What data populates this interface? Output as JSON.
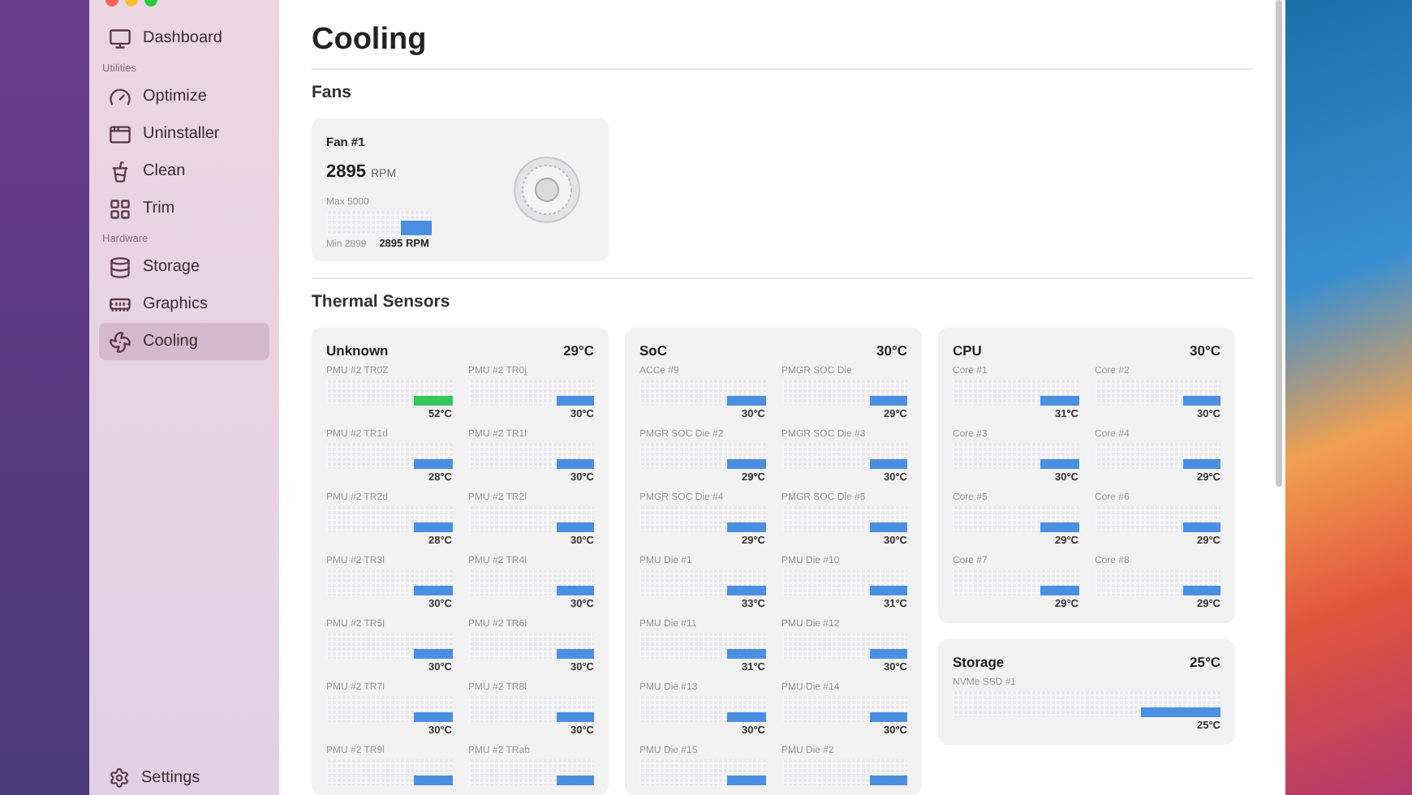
{
  "sidebar": {
    "items": [
      {
        "kind": "item",
        "label": "Dashboard",
        "selected": false
      },
      {
        "kind": "section",
        "label": "Utilities"
      },
      {
        "kind": "item",
        "label": "Optimize",
        "selected": false
      },
      {
        "kind": "item",
        "label": "Uninstaller",
        "selected": false
      },
      {
        "kind": "item",
        "label": "Clean",
        "selected": false
      },
      {
        "kind": "item",
        "label": "Trim",
        "selected": false
      },
      {
        "kind": "section",
        "label": "Hardware"
      },
      {
        "kind": "item",
        "label": "Storage",
        "selected": false
      },
      {
        "kind": "item",
        "label": "Graphics",
        "selected": false
      },
      {
        "kind": "item",
        "label": "Cooling",
        "selected": true
      }
    ],
    "footer": {
      "label": "Settings"
    }
  },
  "page": {
    "title": "Cooling"
  },
  "fans": {
    "heading": "Fans",
    "items": [
      {
        "name": "Fan #1",
        "speed": "2895",
        "unit": "RPM",
        "max": "Max 5000",
        "min": "Min 2899",
        "reading": "2895 RPM"
      }
    ]
  },
  "thermal": {
    "heading": "Thermal Sensors",
    "groups": [
      {
        "name": "Unknown",
        "temp": "29°C",
        "sensors": [
          {
            "name": "PMU #2 TR0Z",
            "reading": "52°C",
            "color": "#34c759"
          },
          {
            "name": "PMU #2 TR0j",
            "reading": "30°C",
            "color": "#4a90e2"
          },
          {
            "name": "PMU #2 TR1d",
            "reading": "28°C",
            "color": "#4a90e2"
          },
          {
            "name": "PMU #2 TR1l",
            "reading": "30°C",
            "color": "#4a90e2"
          },
          {
            "name": "PMU #2 TR2d",
            "reading": "28°C",
            "color": "#4a90e2"
          },
          {
            "name": "PMU #2 TR2l",
            "reading": "30°C",
            "color": "#4a90e2"
          },
          {
            "name": "PMU #2 TR3l",
            "reading": "30°C",
            "color": "#4a90e2"
          },
          {
            "name": "PMU #2 TR4l",
            "reading": "30°C",
            "color": "#4a90e2"
          },
          {
            "name": "PMU #2 TR5l",
            "reading": "30°C",
            "color": "#4a90e2"
          },
          {
            "name": "PMU #2 TR6l",
            "reading": "30°C",
            "color": "#4a90e2"
          },
          {
            "name": "PMU #2 TR7l",
            "reading": "30°C",
            "color": "#4a90e2"
          },
          {
            "name": "PMU #2 TR8l",
            "reading": "30°C",
            "color": "#4a90e2"
          },
          {
            "name": "PMU #2 TR9l",
            "color": "#4a90e2"
          },
          {
            "name": "PMU #2 TRab",
            "color": "#4a90e2"
          }
        ]
      },
      {
        "name": "SoC",
        "temp": "30°C",
        "sensors": [
          {
            "name": "ACCe #9",
            "reading": "30°C",
            "color": "#4a90e2"
          },
          {
            "name": "PMGR SOC Die",
            "reading": "29°C",
            "color": "#4a90e2"
          },
          {
            "name": "PMGR SOC Die #2",
            "reading": "29°C",
            "color": "#4a90e2"
          },
          {
            "name": "PMGR SOC Die #3",
            "reading": "30°C",
            "color": "#4a90e2"
          },
          {
            "name": "PMGR SOC Die #4",
            "reading": "29°C",
            "color": "#4a90e2"
          },
          {
            "name": "PMGR SOC Die #5",
            "reading": "30°C",
            "color": "#4a90e2"
          },
          {
            "name": "PMU Die #1",
            "reading": "33°C",
            "color": "#4a90e2"
          },
          {
            "name": "PMU Die #10",
            "reading": "31°C",
            "color": "#4a90e2"
          },
          {
            "name": "PMU Die #11",
            "reading": "31°C",
            "color": "#4a90e2"
          },
          {
            "name": "PMU Die #12",
            "reading": "30°C",
            "color": "#4a90e2"
          },
          {
            "name": "PMU Die #13",
            "reading": "30°C",
            "color": "#4a90e2"
          },
          {
            "name": "PMU Die #14",
            "reading": "30°C",
            "color": "#4a90e2"
          },
          {
            "name": "PMU Die #15",
            "color": "#4a90e2"
          },
          {
            "name": "PMU Die #2",
            "color": "#4a90e2"
          }
        ]
      },
      {
        "name": "CPU",
        "temp": "30°C",
        "sensors": [
          {
            "name": "Core #1",
            "reading": "31°C",
            "color": "#4a90e2"
          },
          {
            "name": "Core #2",
            "reading": "30°C",
            "color": "#4a90e2"
          },
          {
            "name": "Core #3",
            "reading": "30°C",
            "color": "#4a90e2"
          },
          {
            "name": "Core #4",
            "reading": "29°C",
            "color": "#4a90e2"
          },
          {
            "name": "Core #5",
            "reading": "29°C",
            "color": "#4a90e2"
          },
          {
            "name": "Core #6",
            "reading": "29°C",
            "color": "#4a90e2"
          },
          {
            "name": "Core #7",
            "reading": "29°C",
            "color": "#4a90e2"
          },
          {
            "name": "Core #8",
            "reading": "29°C",
            "color": "#4a90e2"
          }
        ]
      },
      {
        "name": "Storage",
        "temp": "25°C",
        "wide": true,
        "sensors": [
          {
            "name": "NVMe SSD #1",
            "reading": "25°C",
            "color": "#4a90e2"
          }
        ]
      }
    ]
  }
}
